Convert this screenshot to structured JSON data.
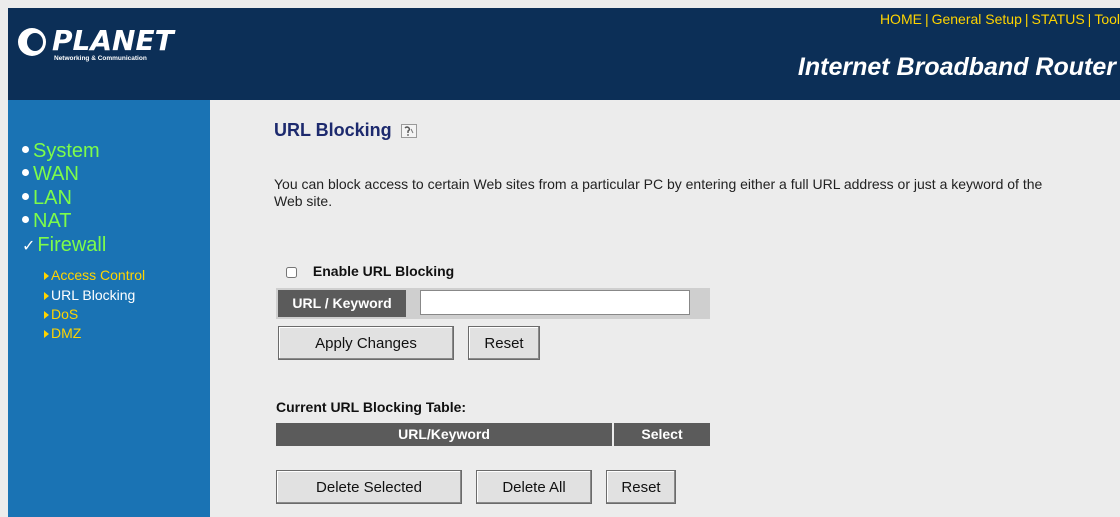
{
  "header": {
    "logo_text": "PLANET",
    "logo_subtitle": "Networking & Communication",
    "title": "Internet Broadband Router",
    "nav": [
      "HOME",
      "General Setup",
      "STATUS",
      "Tool"
    ],
    "nav_separator": "|"
  },
  "sidebar": {
    "items": [
      {
        "label": "System",
        "icon": "bullet-icon"
      },
      {
        "label": "WAN",
        "icon": "bullet-icon"
      },
      {
        "label": "LAN",
        "icon": "bullet-icon"
      },
      {
        "label": "NAT",
        "icon": "bullet-icon"
      },
      {
        "label": "Firewall",
        "icon": "check-icon"
      }
    ],
    "subitems": [
      {
        "label": "Access Control",
        "active": false
      },
      {
        "label": "URL Blocking",
        "active": true
      },
      {
        "label": "DoS",
        "active": false
      },
      {
        "label": "DMZ",
        "active": false
      }
    ]
  },
  "main": {
    "title": "URL Blocking",
    "description": "You can block access to certain Web sites from a particular PC by entering either a full URL address or just a keyword of the Web site.",
    "enable_label": "Enable URL Blocking",
    "enable_checked": false,
    "url_label": "URL / Keyword",
    "url_value": "",
    "apply_label": "Apply Changes",
    "reset_label": "Reset",
    "table_title": "Current URL Blocking Table:",
    "table_columns": [
      "URL/Keyword",
      "Select"
    ],
    "table_rows": [],
    "delete_selected_label": "Delete Selected",
    "delete_all_label": "Delete All",
    "reset2_label": "Reset"
  },
  "colors": {
    "header_bg": "#0c2f57",
    "sidebar_bg": "#1a73b4",
    "menu_text": "#7dfc4a",
    "submenu_text": "#ffd400",
    "nav_text": "#ffd400",
    "table_header_bg": "#5b5b5b"
  }
}
